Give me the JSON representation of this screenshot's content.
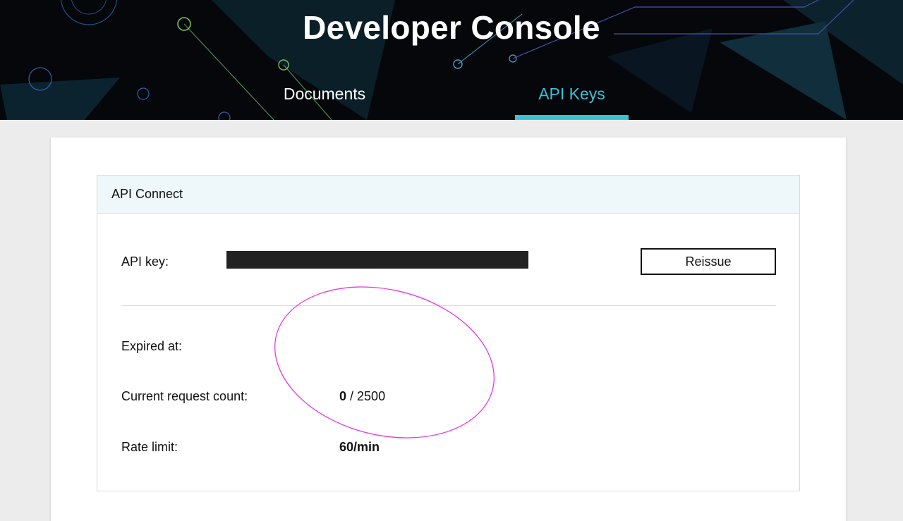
{
  "header": {
    "title": "Developer Console",
    "tabs": [
      {
        "label": "Documents",
        "active": false
      },
      {
        "label": "API Keys",
        "active": true
      }
    ],
    "accent_color": "#3ec0d3"
  },
  "panel": {
    "title": "API Connect",
    "api_key_label": "API key:",
    "api_key_value_redacted": true,
    "reissue_label": "Reissue",
    "expired_label": "Expired at:",
    "expired_value": "",
    "count_label": "Current request count:",
    "count_current": "0",
    "count_separator": " / ",
    "count_max": "2500",
    "rate_label": "Rate limit:",
    "rate_value": "60/min"
  },
  "annotation": {
    "shape": "ellipse",
    "color": "#e838e0"
  }
}
